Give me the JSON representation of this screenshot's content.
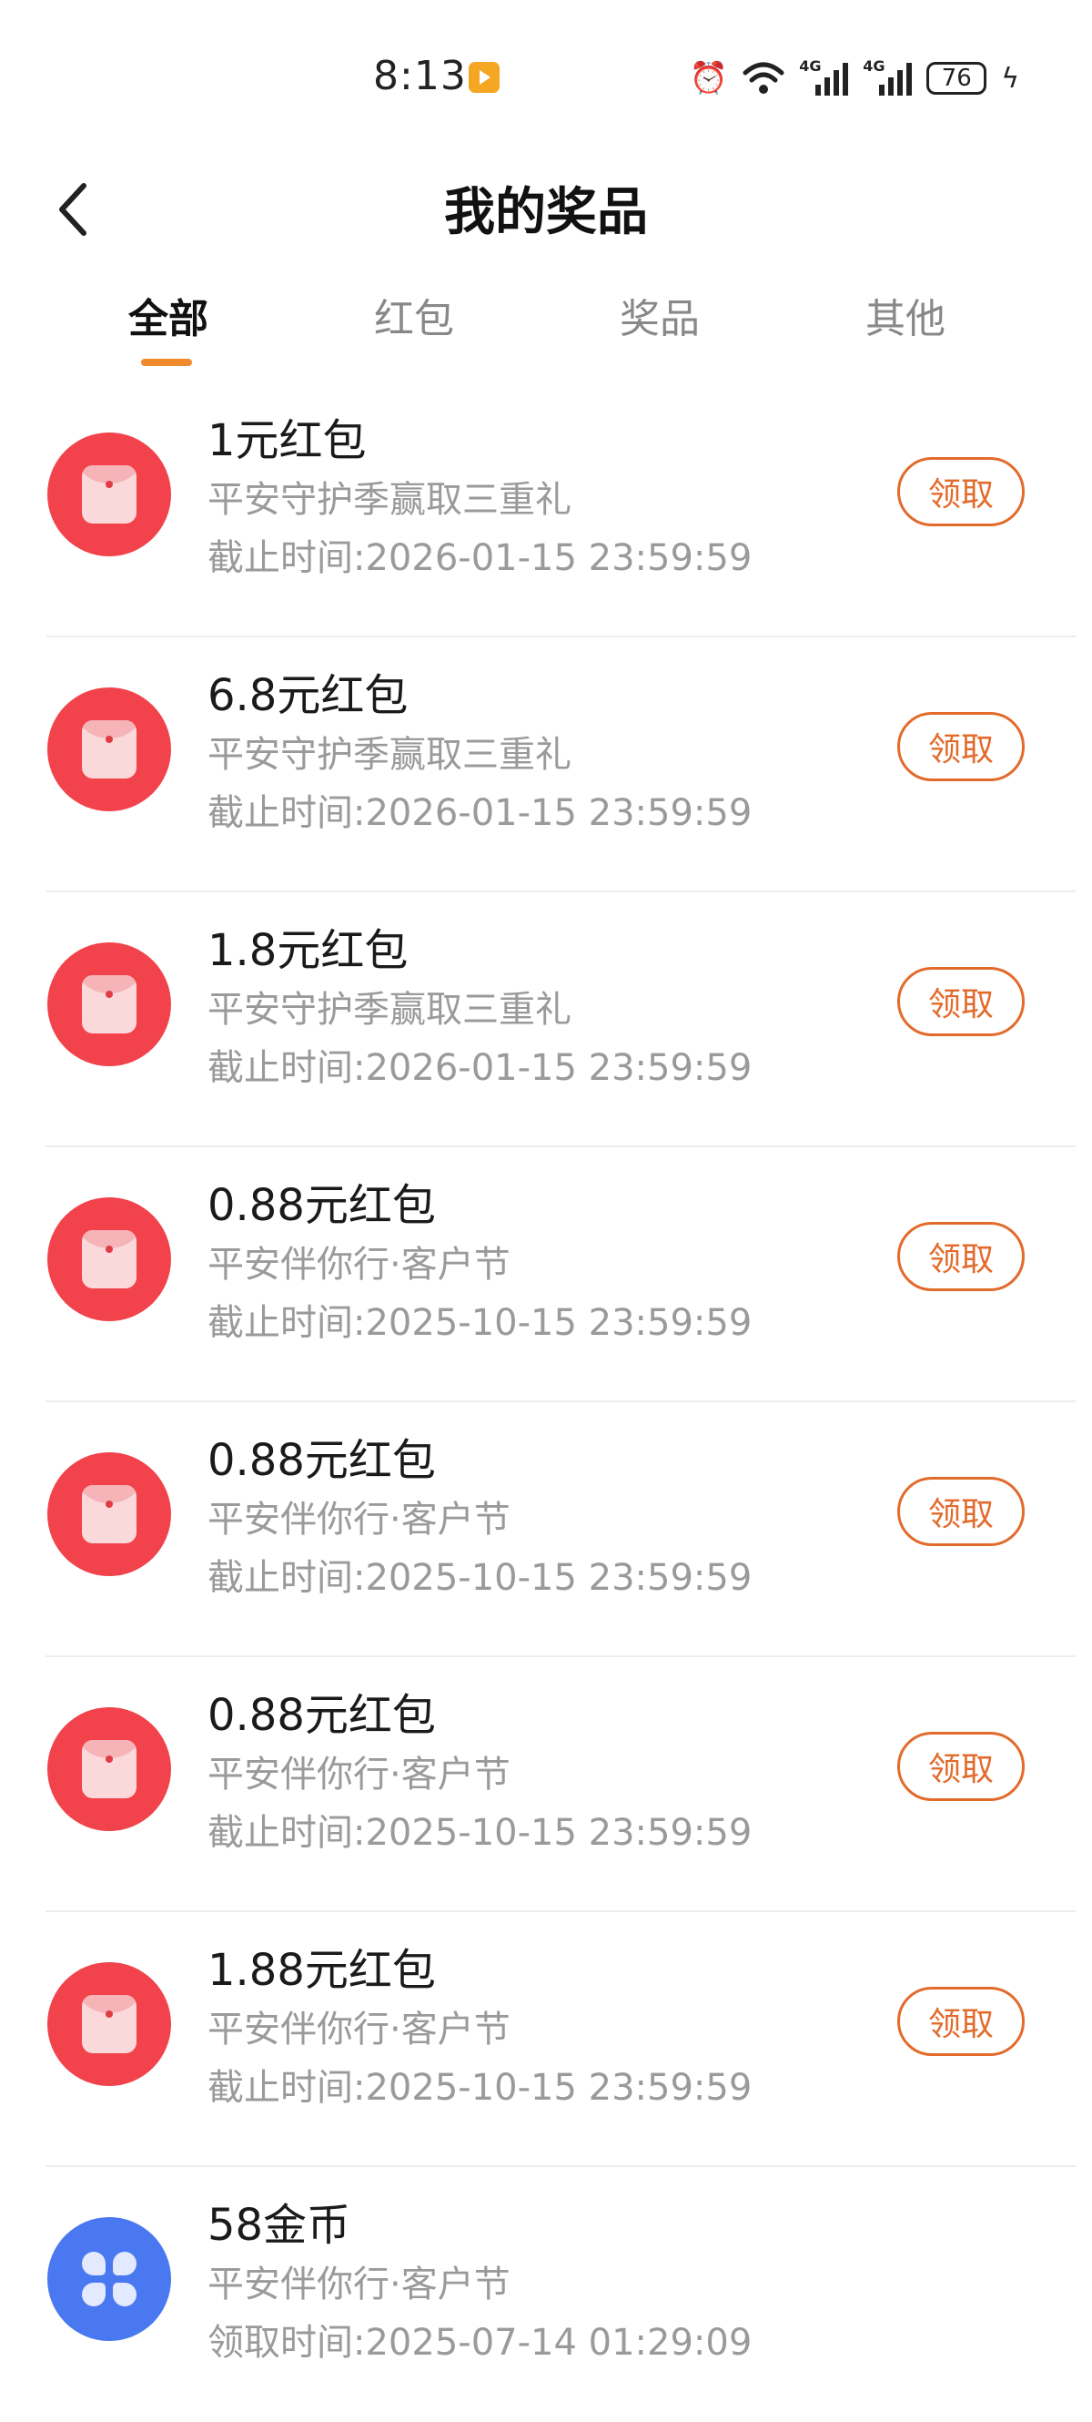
{
  "status_bar": {
    "time": "8:13",
    "network_1": "4G",
    "network_2": "4G",
    "battery": "76"
  },
  "header": {
    "title": "我的奖品"
  },
  "tabs": [
    {
      "label": "全部",
      "active": true
    },
    {
      "label": "红包",
      "active": false
    },
    {
      "label": "奖品",
      "active": false
    },
    {
      "label": "其他",
      "active": false
    }
  ],
  "items": [
    {
      "title": "1元红包",
      "subtitle": "平安守护季赢取三重礼",
      "time": "截止时间:2026-01-15 23:59:59",
      "button": "领取",
      "icon": "red-envelope-icon"
    },
    {
      "title": "6.8元红包",
      "subtitle": "平安守护季赢取三重礼",
      "time": "截止时间:2026-01-15 23:59:59",
      "button": "领取",
      "icon": "red-envelope-icon"
    },
    {
      "title": "1.8元红包",
      "subtitle": "平安守护季赢取三重礼",
      "time": "截止时间:2026-01-15 23:59:59",
      "button": "领取",
      "icon": "red-envelope-icon"
    },
    {
      "title": "0.88元红包",
      "subtitle": "平安伴你行·客户节",
      "time": "截止时间:2025-10-15 23:59:59",
      "button": "领取",
      "icon": "red-envelope-icon"
    },
    {
      "title": "0.88元红包",
      "subtitle": "平安伴你行·客户节",
      "time": "截止时间:2025-10-15 23:59:59",
      "button": "领取",
      "icon": "red-envelope-icon"
    },
    {
      "title": "0.88元红包",
      "subtitle": "平安伴你行·客户节",
      "time": "截止时间:2025-10-15 23:59:59",
      "button": "领取",
      "icon": "red-envelope-icon"
    },
    {
      "title": "1.88元红包",
      "subtitle": "平安伴你行·客户节",
      "time": "截止时间:2025-10-15 23:59:59",
      "button": "领取",
      "icon": "red-envelope-icon"
    },
    {
      "title": "58金币",
      "subtitle": "平安伴你行·客户节",
      "time": "领取时间:2025-07-14 01:29:09",
      "icon": "gold-coin-icon"
    }
  ],
  "colors": {
    "accent": "#E26B2C",
    "tab_indicator": "#F08A2C",
    "envelope_red": "#F2424B",
    "coin_blue": "#4A78F0"
  }
}
